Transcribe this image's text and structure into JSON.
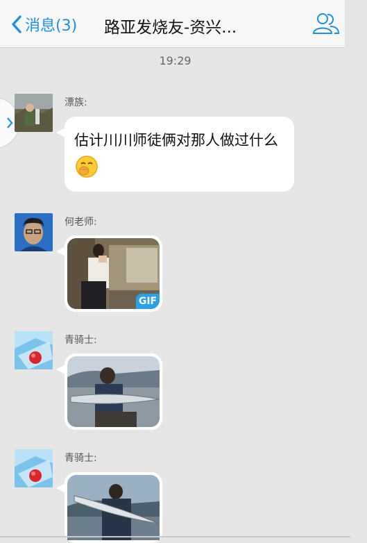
{
  "header": {
    "back_label": "消息(3)",
    "title": "路亚发烧友-资兴...",
    "members_icon": "group-members-icon"
  },
  "timestamp": "19:29",
  "messages": [
    {
      "sender": "漂族:",
      "text": "估计川川师徒俩对那人做过什么",
      "emoji": "grin-face-emoji",
      "type": "text"
    },
    {
      "sender": "何老师:",
      "type": "gif",
      "badge": "GIF"
    },
    {
      "sender": "青骑士:",
      "type": "image"
    },
    {
      "sender": "青骑士:",
      "type": "image"
    }
  ],
  "colors": {
    "accent": "#1f8fe6",
    "background": "#e6e6e6",
    "bubble": "#ffffff",
    "gif_badge": "#2aa0e8"
  }
}
